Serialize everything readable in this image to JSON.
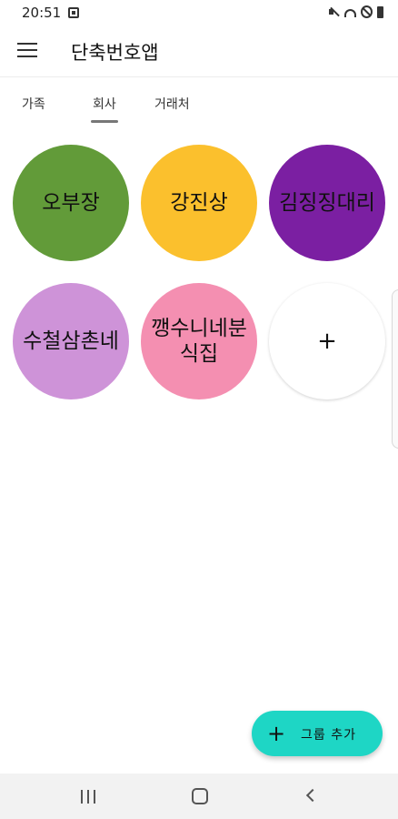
{
  "status_bar": {
    "time": "20:51",
    "icons": [
      "app-notification-icon",
      "mute-icon",
      "wifi-icon",
      "dnd-icon",
      "battery-icon"
    ]
  },
  "app_bar": {
    "title": "단축번호앱",
    "menu_icon": "hamburger-menu-icon"
  },
  "tabs": [
    {
      "label": "가족",
      "selected": false
    },
    {
      "label": "회사",
      "selected": true
    },
    {
      "label": "거래처",
      "selected": false
    }
  ],
  "contacts": [
    {
      "name": "오부장",
      "color": "#629b39"
    },
    {
      "name": "강진상",
      "color": "#fbc02d"
    },
    {
      "name": "김징징대리",
      "color": "#7b1fa2"
    },
    {
      "name": "수철삼촌네",
      "color": "#ce93d8"
    },
    {
      "name": "깽수니네분식집",
      "color": "#f48fb1"
    }
  ],
  "add_contact": {
    "label": "+",
    "color": "#ffffff"
  },
  "fab": {
    "icon": "+",
    "label": "그룹 추가",
    "color": "#1ed6c5"
  },
  "nav_bar": {
    "icons": [
      "recent-apps-icon",
      "home-icon",
      "back-icon"
    ]
  }
}
